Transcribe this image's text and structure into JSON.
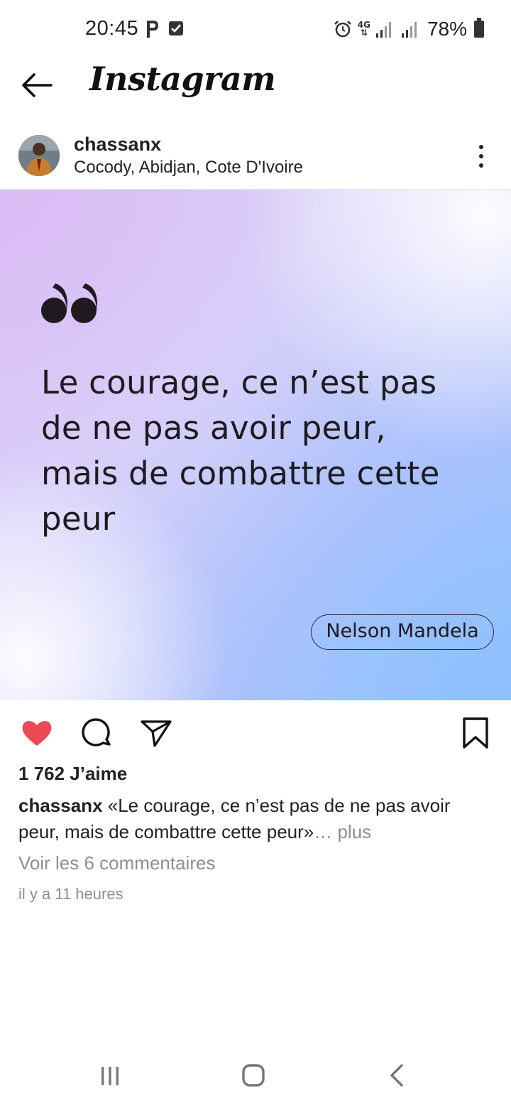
{
  "status_bar": {
    "time": "20:45",
    "network": "4G",
    "battery": "78%"
  },
  "header": {
    "title": "Instagram",
    "back_icon": "arrow-left-icon"
  },
  "post": {
    "username": "chassanx",
    "location": "Cocody, Abidjan, Cote D'Ivoire",
    "image": {
      "quote": "Le courage, ce n’est pas de ne pas avoir peur, mais de combattre cette peur",
      "quote_lines": [
        "Le courage, ce n’est pas",
        "de ne pas avoir peur,",
        "mais de combattre cette",
        "peur"
      ],
      "author": "Nelson Mandela"
    },
    "liked": true,
    "likes": "1 762 J’aime",
    "caption_user": "chassanx",
    "caption_text": " «Le courage, ce n’est pas de ne pas avoir peur, mais de combattre cette peur»",
    "caption_more": "… plus",
    "view_comments": "Voir les 6 commentaires",
    "timestamp": "il y a 11 heures"
  },
  "colors": {
    "like_red": "#ed4956",
    "muted": "#8e8e8e"
  }
}
